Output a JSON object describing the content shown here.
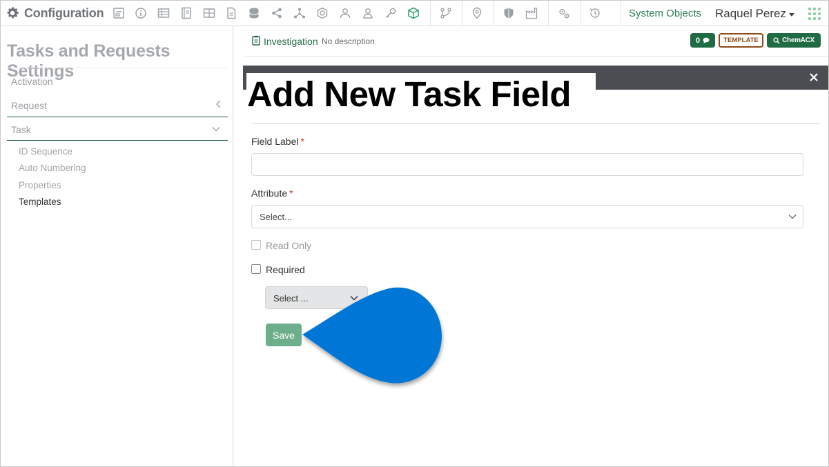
{
  "app": {
    "title": "Configuration",
    "system_objects": "System Objects",
    "user_name": "Raquel Perez"
  },
  "toolbar_icons": [
    "forms-icon",
    "info-icon",
    "table-icon",
    "notebook-icon",
    "grid-icon",
    "document-icon",
    "database-icon",
    "share-icon",
    "network-icon",
    "hexagon-icon",
    "users-icon",
    "user-icon",
    "key-icon",
    "cube-icon",
    "workflow-icon",
    "location-icon",
    "shield-icon",
    "factory-icon",
    "settings-icon",
    "history-icon",
    "apps-grid-icon"
  ],
  "sidebar": {
    "title": "Tasks and Requests Settings",
    "items": [
      {
        "label": "Activation"
      },
      {
        "label": "Request"
      },
      {
        "label": "Task"
      }
    ],
    "task_subitems": [
      {
        "label": "ID Sequence",
        "active": false
      },
      {
        "label": "Auto Numbering",
        "active": false
      },
      {
        "label": "Properties",
        "active": false
      },
      {
        "label": "Templates",
        "active": true
      }
    ]
  },
  "header": {
    "object_name": "Investigation",
    "description": "No description",
    "comment_count": "0",
    "template_badge": "TEMPLATE",
    "chem_badge": "ChemACX"
  },
  "modal": {
    "title": "Add New Task Field",
    "field_label": "Field Label",
    "field_label_value": "",
    "attribute_label": "Attribute",
    "attribute_placeholder": "Select...",
    "read_only_label": "Read Only",
    "required_label": "Required",
    "type_select_value": "Select ...",
    "save_label": "Save",
    "required_marker": "*"
  },
  "colors": {
    "accent_green": "#1f6b43",
    "link_green": "#2d7d55",
    "template_brown": "#8d4a1a",
    "modal_bar": "#4a4d51",
    "save_button": "#6daf8c",
    "pointer_blue": "#0277d6"
  }
}
